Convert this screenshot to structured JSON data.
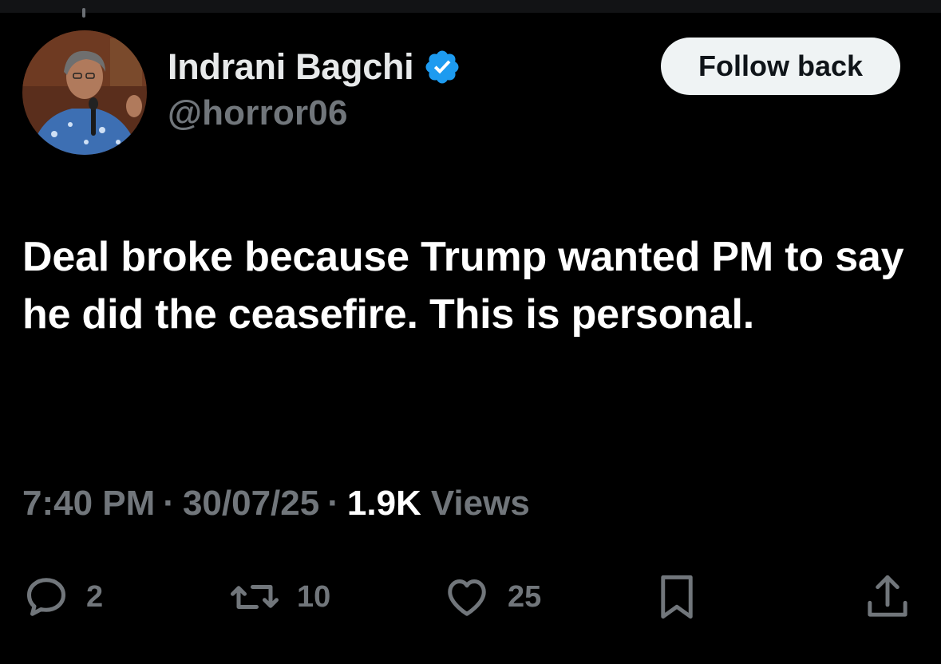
{
  "author": {
    "display_name": "Indrani Bagchi",
    "handle": "@horror06",
    "verified": true
  },
  "follow_button": {
    "label": "Follow back"
  },
  "tweet": {
    "text": "Deal broke because Trump wanted PM to say he did the ceasefire. This is personal."
  },
  "meta": {
    "time": "7:40 PM",
    "separator": "·",
    "date": "30/07/25",
    "views_count": "1.9K",
    "views_label": "Views"
  },
  "actions": {
    "replies": "2",
    "reposts": "10",
    "likes": "25"
  },
  "icons": {
    "reply": "speech-bubble-icon",
    "repost": "repost-arrows-icon",
    "like": "heart-icon",
    "bookmark": "bookmark-icon",
    "share": "share-upload-icon",
    "verified": "verified-badge-icon"
  },
  "colors": {
    "background": "#000000",
    "text_primary": "#ffffff",
    "text_secondary": "#71767b",
    "verified_blue": "#1d9bf0",
    "button_bg": "#eff3f4",
    "button_text": "#0f1419"
  }
}
